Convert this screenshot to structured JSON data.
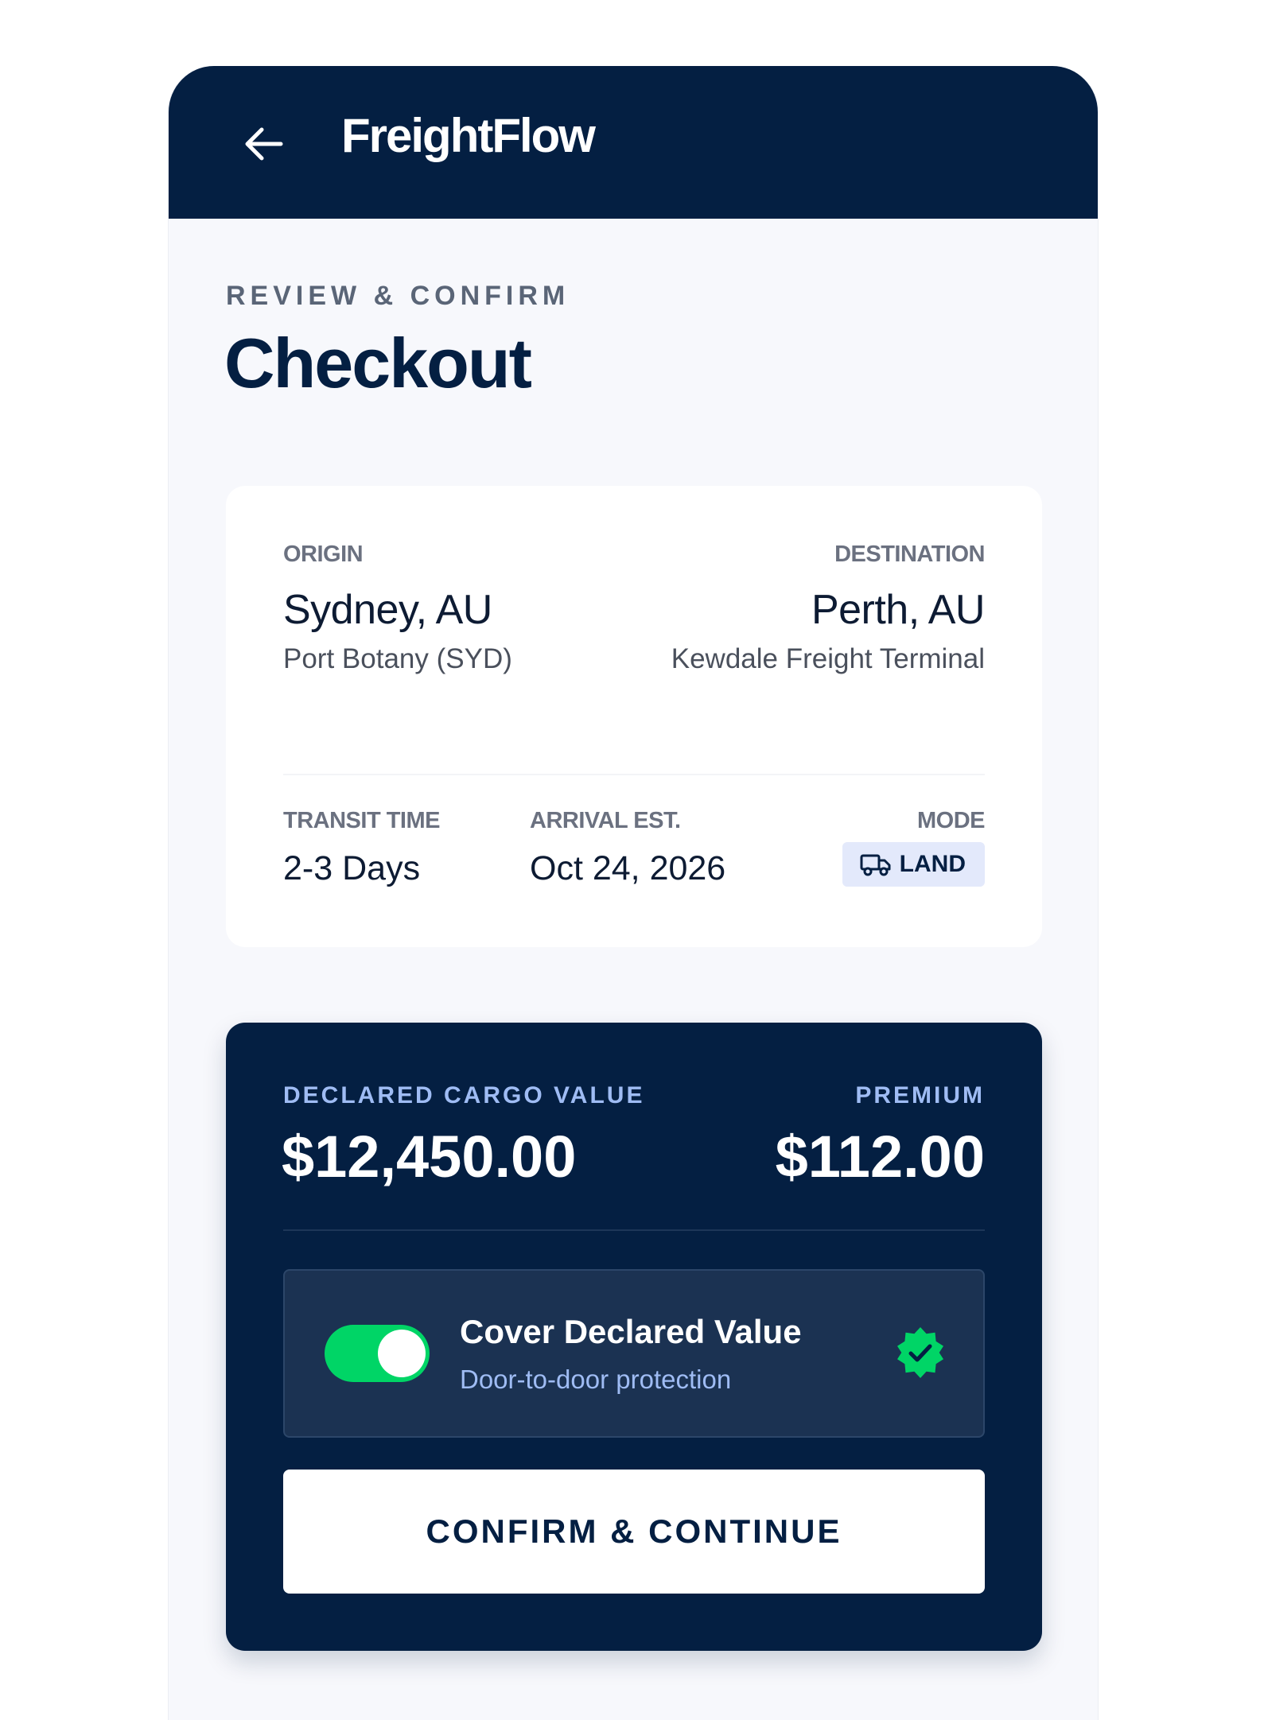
{
  "colors": {
    "navy": "#041f42",
    "accent_blue": "#9fbcf4",
    "badge_bg": "#e3e9fb",
    "toggle_on": "#00d566",
    "verified_green": "#00d566",
    "page_bg": "#f7f8fc"
  },
  "header": {
    "back_icon": "arrow-left-icon",
    "brand": "FreightFlow"
  },
  "page": {
    "eyebrow": "REVIEW & CONFIRM",
    "title": "Checkout"
  },
  "route": {
    "origin_label": "ORIGIN",
    "origin_city": "Sydney, AU",
    "origin_port": "Port Botany (SYD)",
    "destination_label": "DESTINATION",
    "destination_city": "Perth, AU",
    "destination_port": "Kewdale Freight Terminal",
    "transit_label": "TRANSIT TIME",
    "transit_value": "2-3 Days",
    "arrival_label": "ARRIVAL EST.",
    "arrival_value": "Oct 24, 2026",
    "mode_label": "MODE",
    "mode_value": "LAND",
    "mode_icon": "truck-icon"
  },
  "insurance": {
    "declared_label": "DECLARED CARGO VALUE",
    "declared_value": "$12,450.00",
    "premium_label": "PREMIUM",
    "premium_value": "$112.00",
    "cover_title": "Cover Declared Value",
    "cover_subtitle": "Door-to-door protection",
    "cover_enabled": true,
    "verified_icon": "verified-badge-icon"
  },
  "actions": {
    "confirm_label": "CONFIRM & CONTINUE"
  }
}
